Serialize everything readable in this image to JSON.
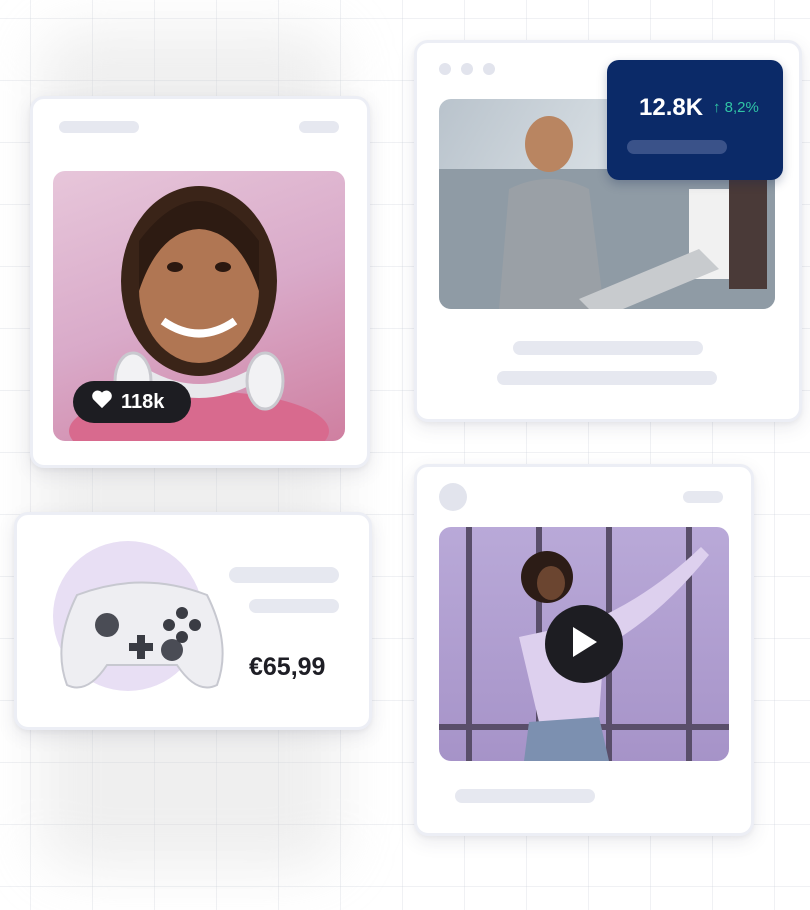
{
  "cards": {
    "profile": {
      "likes": "118k",
      "icon": "heart-icon"
    },
    "analytics": {
      "value": "12.8K",
      "change": "↑ 8,2%",
      "accent": "#0b2a68",
      "change_color": "#30c4a5"
    },
    "product": {
      "price": "€65,99",
      "icon": "gamepad-icon"
    },
    "video": {
      "icon": "play-icon"
    }
  }
}
